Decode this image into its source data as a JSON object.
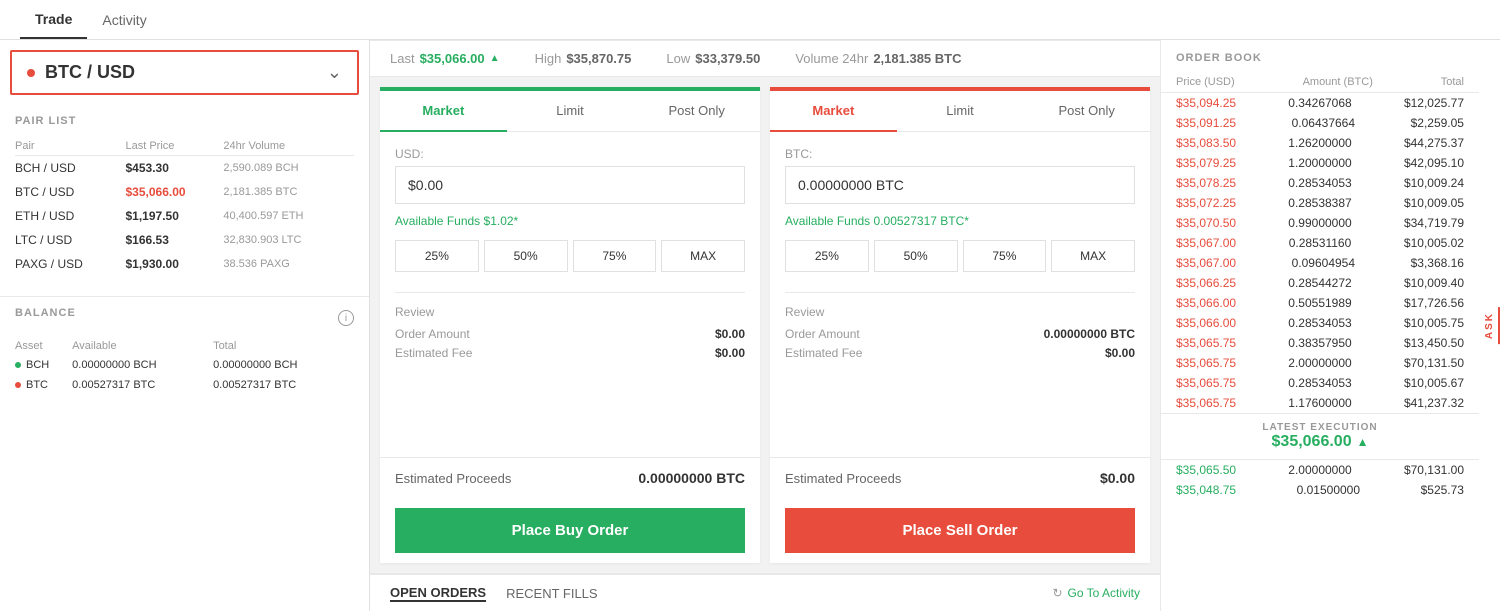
{
  "nav": {
    "tabs": [
      {
        "label": "Trade",
        "active": true
      },
      {
        "label": "Activity",
        "active": false
      }
    ]
  },
  "pair_selector": {
    "name": "BTC / USD",
    "dot_color": "#e74c3c"
  },
  "ticker": {
    "last_label": "Last",
    "last_value": "$35,066.00",
    "last_up": true,
    "high_label": "High",
    "high_value": "$35,870.75",
    "low_label": "Low",
    "low_value": "$33,379.50",
    "volume_label": "Volume 24hr",
    "volume_value": "2,181.385 BTC"
  },
  "pair_list": {
    "title": "PAIR LIST",
    "headers": [
      "Pair",
      "Last Price",
      "24hr Volume"
    ],
    "rows": [
      {
        "pair": "BCH / USD",
        "price": "$453.30",
        "volume": "2,590.089 BCH",
        "active": false
      },
      {
        "pair": "BTC / USD",
        "price": "$35,066.00",
        "volume": "2,181.385 BTC",
        "active": true
      },
      {
        "pair": "ETH / USD",
        "price": "$1,197.50",
        "volume": "40,400.597 ETH",
        "active": false
      },
      {
        "pair": "LTC / USD",
        "price": "$166.53",
        "volume": "32,830.903 LTC",
        "active": false
      },
      {
        "pair": "PAXG / USD",
        "price": "$1,930.00",
        "volume": "38.536 PAXG",
        "active": false
      }
    ]
  },
  "balance": {
    "title": "BALANCE",
    "headers": [
      "Asset",
      "Available",
      "Total"
    ],
    "rows": [
      {
        "asset": "BCH",
        "dot": "green",
        "available": "0.00000000 BCH",
        "total": "0.00000000 BCH"
      },
      {
        "asset": "BTC",
        "dot": "red",
        "available": "0.00527317 BTC",
        "total": "0.00527317 BTC"
      }
    ]
  },
  "buy_panel": {
    "top_color": "green",
    "tabs": [
      "Market",
      "Limit",
      "Post Only"
    ],
    "active_tab": "Market",
    "currency_label": "USD:",
    "input_value": "$0.00",
    "available_funds_label": "Available Funds",
    "available_funds_value": "$1.02",
    "available_funds_note": "*",
    "pct_buttons": [
      "25%",
      "50%",
      "75%",
      "MAX"
    ],
    "review_title": "Review",
    "order_amount_label": "Order Amount",
    "order_amount_value": "$0.00",
    "estimated_fee_label": "Estimated Fee",
    "estimated_fee_value": "$0.00",
    "estimated_proceeds_label": "Estimated Proceeds",
    "estimated_proceeds_value": "0.00000000 BTC",
    "button_label": "Place Buy Order",
    "button_color": "green"
  },
  "sell_panel": {
    "top_color": "red",
    "tabs": [
      "Market",
      "Limit",
      "Post Only"
    ],
    "active_tab": "Market",
    "currency_label": "BTC:",
    "input_value": "0.00000000 BTC",
    "available_funds_label": "Available Funds",
    "available_funds_value": "0.00527317 BTC",
    "available_funds_note": "*",
    "pct_buttons": [
      "25%",
      "50%",
      "75%",
      "MAX"
    ],
    "review_title": "Review",
    "order_amount_label": "Order Amount",
    "order_amount_value": "0.00000000 BTC",
    "estimated_fee_label": "Estimated Fee",
    "estimated_fee_value": "$0.00",
    "estimated_proceeds_label": "Estimated Proceeds",
    "estimated_proceeds_value": "$0.00",
    "button_label": "Place Sell Order",
    "button_color": "red"
  },
  "order_book": {
    "title": "ORDER BOOK",
    "headers": [
      "Price (USD)",
      "Amount (BTC)",
      "Total"
    ],
    "ask_rows": [
      {
        "price": "$35,094.25",
        "amount": "0.34267068",
        "total": "$12,025.77"
      },
      {
        "price": "$35,091.25",
        "amount": "0.06437664",
        "total": "$2,259.05"
      },
      {
        "price": "$35,083.50",
        "amount": "1.26200000",
        "total": "$44,275.37"
      },
      {
        "price": "$35,079.25",
        "amount": "1.20000000",
        "total": "$42,095.10"
      },
      {
        "price": "$35,078.25",
        "amount": "0.28534053",
        "total": "$10,009.24"
      },
      {
        "price": "$35,072.25",
        "amount": "0.28538387",
        "total": "$10,009.05"
      },
      {
        "price": "$35,070.50",
        "amount": "0.99000000",
        "total": "$34,719.79"
      },
      {
        "price": "$35,067.00",
        "amount": "0.28531160",
        "total": "$10,005.02"
      },
      {
        "price": "$35,067.00",
        "amount": "0.09604954",
        "total": "$3,368.16"
      },
      {
        "price": "$35,066.25",
        "amount": "0.28544272",
        "total": "$10,009.40"
      },
      {
        "price": "$35,066.00",
        "amount": "0.50551989",
        "total": "$17,726.56"
      },
      {
        "price": "$35,066.00",
        "amount": "0.28534053",
        "total": "$10,005.75"
      },
      {
        "price": "$35,065.75",
        "amount": "0.38357950",
        "total": "$13,450.50"
      },
      {
        "price": "$35,065.75",
        "amount": "2.00000000",
        "total": "$70,131.50"
      },
      {
        "price": "$35,065.75",
        "amount": "0.28534053",
        "total": "$10,005.67"
      },
      {
        "price": "$35,065.75",
        "amount": "1.17600000",
        "total": "$41,237.32"
      }
    ],
    "latest_execution_label": "LATEST EXECUTION",
    "latest_execution_value": "$35,066.00",
    "latest_execution_up": true,
    "bid_rows": [
      {
        "price": "$35,065.50",
        "amount": "2.00000000",
        "total": "$70,131.00"
      },
      {
        "price": "$35,048.75",
        "amount": "0.01500000",
        "total": "$525.73"
      }
    ]
  },
  "bottom_bar": {
    "tabs": [
      "OPEN ORDERS",
      "RECENT FILLS"
    ],
    "active_tab": "OPEN ORDERS",
    "go_to_activity": "Go To Activity"
  }
}
